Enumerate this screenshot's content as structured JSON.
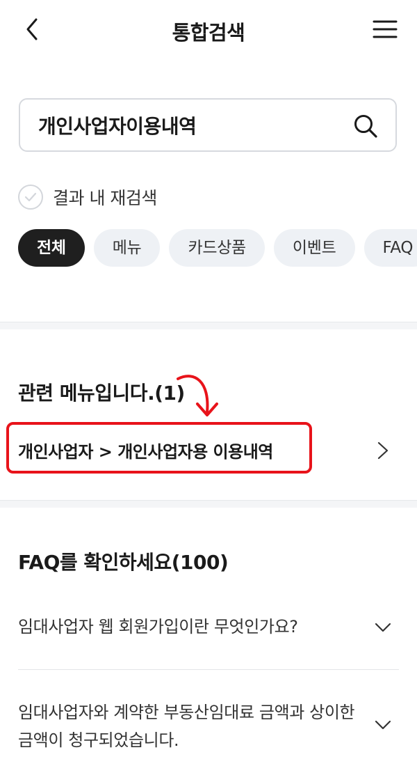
{
  "header": {
    "title": "통합검색"
  },
  "search": {
    "value": "개인사업자이용내역",
    "placeholder": ""
  },
  "research": {
    "label": "결과 내 재검색",
    "checked": false
  },
  "chips": [
    {
      "label": "전체",
      "active": true
    },
    {
      "label": "메뉴",
      "active": false
    },
    {
      "label": "카드상품",
      "active": false
    },
    {
      "label": "이벤트",
      "active": false
    },
    {
      "label": "FAQ",
      "active": false
    }
  ],
  "related": {
    "title": "관련 메뉴입니다.(1)",
    "items": [
      {
        "label": "개인사업자 > 개인사업자용 이용내역"
      }
    ]
  },
  "faq": {
    "title": "FAQ를 확인하세요(100)",
    "items": [
      {
        "question": "임대사업자 웹 회원가입이란 무엇인가요?"
      },
      {
        "question": "임대사업자와 계약한 부동산임대료 금액과 상이한 금액이 청구되었습니다."
      }
    ]
  },
  "colors": {
    "accent_dark": "#1f1f1f",
    "chip_bg": "#eef1f5",
    "annotation_red": "#e8131a"
  }
}
